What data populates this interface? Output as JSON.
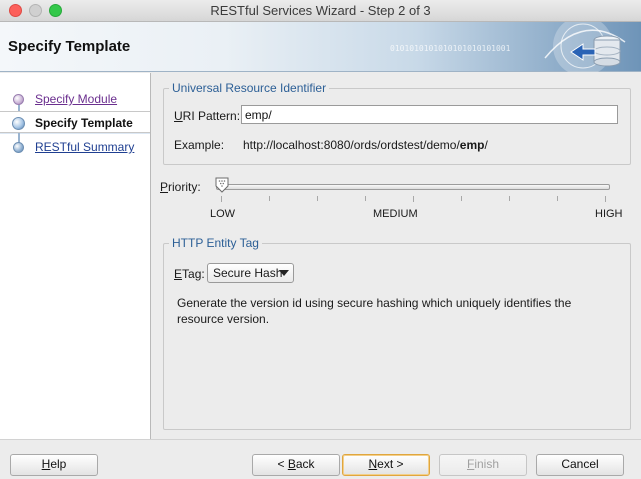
{
  "window": {
    "title": "RESTful Services Wizard - Step 2 of 3"
  },
  "banner": {
    "title": "Specify Template",
    "binary_text": "0101010101010101010101001"
  },
  "nav": {
    "items": [
      {
        "label": "Specify Module",
        "state": "visited"
      },
      {
        "label": "Specify Template",
        "state": "current"
      },
      {
        "label": "RESTful Summary",
        "state": "upcoming"
      }
    ]
  },
  "uri": {
    "legend": "Universal Resource Identifier",
    "pattern_label_mnemonic": "U",
    "pattern_label_rest": "RI Pattern:",
    "pattern_value": "emp/",
    "example_label": "Example:",
    "example_prefix": "http://localhost:8080/ords/ordstest/demo/",
    "example_bold": "emp",
    "example_suffix": "/"
  },
  "priority": {
    "label_mnemonic": "P",
    "label_rest": "riority:",
    "low": "LOW",
    "medium": "MEDIUM",
    "high": "HIGH",
    "level": 0
  },
  "etag": {
    "legend": "HTTP Entity Tag",
    "label_mnemonic": "E",
    "label_rest": "Tag:",
    "selected": "Secure Hash",
    "description": "Generate the version id using secure hashing which uniquely identifies the resource version."
  },
  "buttons": {
    "help_mnemonic": "H",
    "help_rest": "elp",
    "back_prefix": "< ",
    "back_mnemonic": "B",
    "back_rest": "ack",
    "next_mnemonic": "N",
    "next_rest": "ext >",
    "finish_mnemonic": "F",
    "finish_rest": "inish",
    "cancel": "Cancel"
  },
  "colors": {
    "legend_text": "#2c5f96",
    "primary_button_border": "#e0a63e"
  }
}
